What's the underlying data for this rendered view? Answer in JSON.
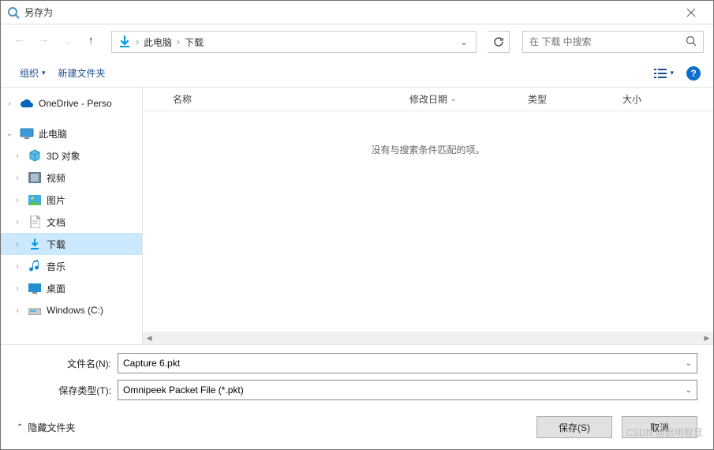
{
  "title": "另存为",
  "breadcrumbs": [
    "此电脑",
    "下载"
  ],
  "search": {
    "placeholder": "在 下载 中搜索"
  },
  "toolbar": {
    "organize": "组织",
    "newfolder": "新建文件夹"
  },
  "columns": {
    "name": "名称",
    "date": "修改日期",
    "type": "类型",
    "size": "大小"
  },
  "empty_message": "没有与搜索条件匹配的项。",
  "tree": {
    "onedrive": "OneDrive - Perso",
    "thispc": "此电脑",
    "objects3d": "3D 对象",
    "videos": "视频",
    "pictures": "图片",
    "documents": "文档",
    "downloads": "下载",
    "music": "音乐",
    "desktop": "桌面",
    "windowsc": "Windows (C:)"
  },
  "form": {
    "filename_label": "文件名(N):",
    "filename_value": "Capture 6.pkt",
    "filetype_label": "保存类型(T):",
    "filetype_value": "Omnipeek Packet File (*.pkt)"
  },
  "actions": {
    "hide_folders": "隐藏文件夹",
    "save": "保存(S)",
    "cancel": "取消"
  },
  "watermark": "CSDN @启明智显"
}
